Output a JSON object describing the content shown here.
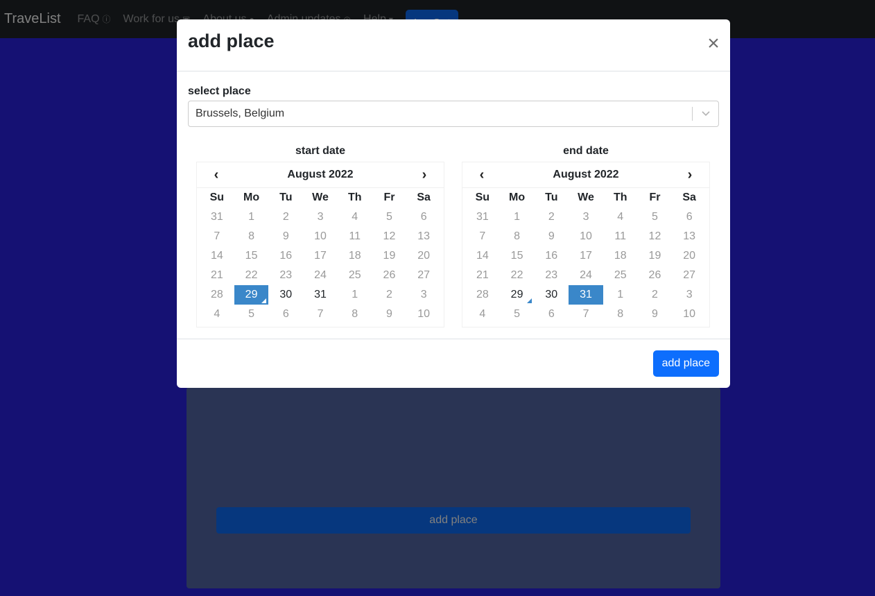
{
  "navbar": {
    "brand": "TraveList",
    "links": [
      {
        "label": "FAQ",
        "icon": "question-circle-icon"
      },
      {
        "label": "Work for us",
        "icon": "briefcase-icon"
      },
      {
        "label": "About us",
        "icon": "people-icon"
      },
      {
        "label": "Admin updates",
        "icon": "globe-icon"
      },
      {
        "label": "Help",
        "icon": "caret-down-icon"
      }
    ],
    "logout_label": "LogOut"
  },
  "page": {
    "add_place_label": "add place"
  },
  "modal": {
    "title": "add place",
    "close_symbol": "×",
    "select_label": "select place",
    "select_value": "Brussels, Belgium",
    "start_label": "start date",
    "end_label": "end date",
    "footer_button": "add place"
  },
  "calendar": {
    "prev_symbol": "‹",
    "next_symbol": "›",
    "weekdays": [
      "Su",
      "Mo",
      "Tu",
      "We",
      "Th",
      "Fr",
      "Sa"
    ],
    "start": {
      "month": "August 2022",
      "weeks": [
        [
          "31",
          "1",
          "2",
          "3",
          "4",
          "5",
          "6"
        ],
        [
          "7",
          "8",
          "9",
          "10",
          "11",
          "12",
          "13"
        ],
        [
          "14",
          "15",
          "16",
          "17",
          "18",
          "19",
          "20"
        ],
        [
          "21",
          "22",
          "23",
          "24",
          "25",
          "26",
          "27"
        ],
        [
          "28",
          "29",
          "30",
          "31",
          "1",
          "2",
          "3"
        ],
        [
          "4",
          "5",
          "6",
          "7",
          "8",
          "9",
          "10"
        ]
      ],
      "selected": "29",
      "today": "29",
      "enabled": [
        "29",
        "30",
        "31"
      ]
    },
    "end": {
      "month": "August 2022",
      "weeks": [
        [
          "31",
          "1",
          "2",
          "3",
          "4",
          "5",
          "6"
        ],
        [
          "7",
          "8",
          "9",
          "10",
          "11",
          "12",
          "13"
        ],
        [
          "14",
          "15",
          "16",
          "17",
          "18",
          "19",
          "20"
        ],
        [
          "21",
          "22",
          "23",
          "24",
          "25",
          "26",
          "27"
        ],
        [
          "28",
          "29",
          "30",
          "31",
          "1",
          "2",
          "3"
        ],
        [
          "4",
          "5",
          "6",
          "7",
          "8",
          "9",
          "10"
        ]
      ],
      "selected": "31",
      "today": "29",
      "enabled": [
        "29",
        "30",
        "31"
      ]
    }
  },
  "colors": {
    "primary": "#0d6efd",
    "selected_day": "#3a87c9"
  }
}
